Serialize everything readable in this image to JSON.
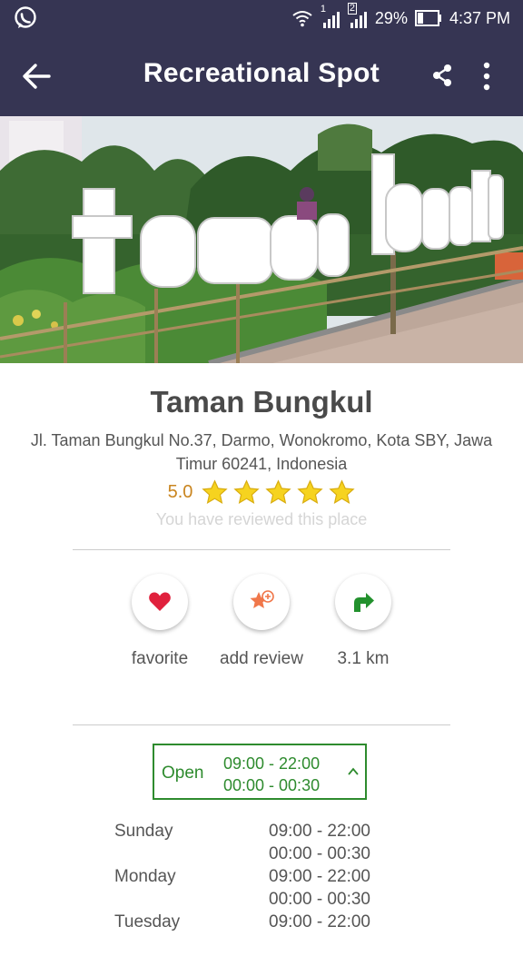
{
  "status_bar": {
    "battery": "29%",
    "time": "4:37 PM",
    "sim1": "1",
    "sim2": "2",
    "icons": [
      "whatsapp-icon",
      "wifi-icon",
      "signal-icon",
      "battery-icon"
    ]
  },
  "app_bar": {
    "title": "Recreational Spot",
    "icons": [
      "back-arrow-icon",
      "share-icon",
      "more-vert-icon"
    ]
  },
  "hero_image": {
    "sign_text": [
      "taman",
      "bungkul"
    ]
  },
  "place": {
    "name": "Taman Bungkul",
    "address": "Jl. Taman Bungkul No.37, Darmo, Wonokromo, Kota SBY, Jawa Timur 60241, Indonesia",
    "rating": "5.0",
    "stars": 5,
    "reviewed_note": "You have reviewed this place"
  },
  "actions": [
    {
      "label": "favorite",
      "icon": "heart-icon",
      "color": "#e0213d"
    },
    {
      "label": "add review",
      "icon": "star-plus-icon",
      "color": "#f0774a"
    },
    {
      "label": "3.1 km",
      "icon": "directions-icon",
      "color": "#22912d"
    }
  ],
  "opening": {
    "status": "Open",
    "times": [
      "09:00 - 22:00",
      "00:00 - 00:30"
    ]
  },
  "hours": [
    {
      "day": "Sunday",
      "t1": "09:00 - 22:00",
      "t2": "00:00 - 00:30"
    },
    {
      "day": "Monday",
      "t1": "09:00 - 22:00",
      "t2": "00:00 - 00:30"
    },
    {
      "day": "Tuesday",
      "t1": "09:00 - 22:00",
      "t2": ""
    }
  ],
  "colors": {
    "app_bar": "#363553",
    "rating": "#c9851f",
    "star": "#f6d31f",
    "open_green": "#2e8b2e"
  }
}
